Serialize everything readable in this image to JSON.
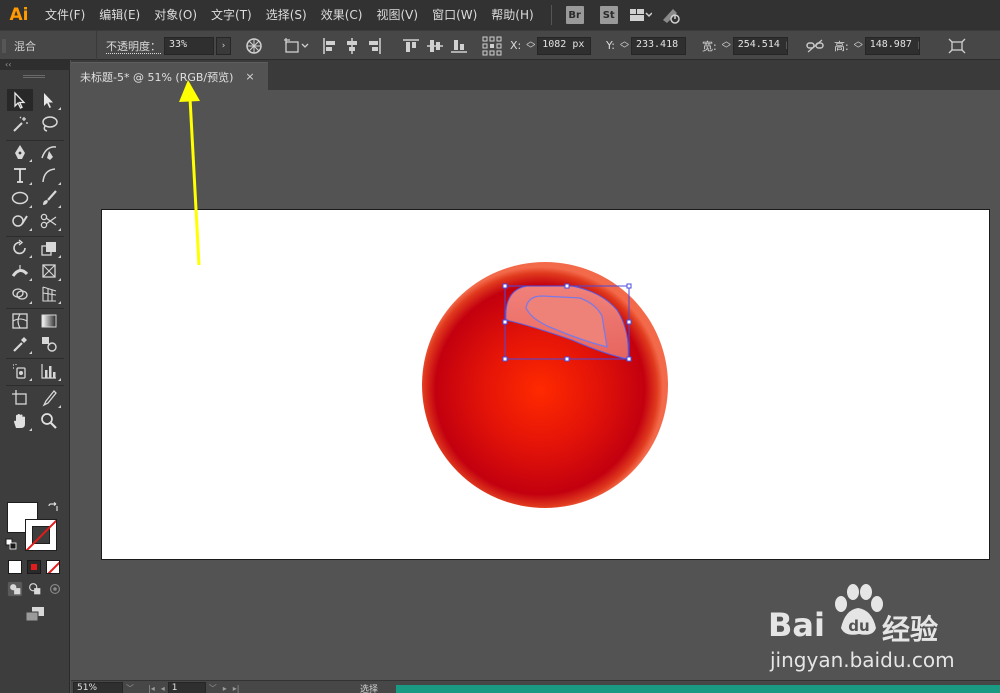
{
  "app": {
    "logo": "Ai",
    "brand_color": "#ff9a00"
  },
  "menu": {
    "items": [
      "文件(F)",
      "编辑(E)",
      "对象(O)",
      "文字(T)",
      "选择(S)",
      "效果(C)",
      "视图(V)",
      "窗口(W)",
      "帮助(H)"
    ],
    "bridge_label": "Br",
    "stock_label": "St"
  },
  "control_bar": {
    "mode_label": "混合",
    "opacity_label": "不透明度：",
    "opacity_value": "33%",
    "x_label": "X:",
    "x_value": "1082 px",
    "y_label": "Y:",
    "y_value": "233.418 p",
    "w_label": "宽:",
    "w_value": "254.514 p",
    "h_label": "高:",
    "h_value": "148.987 p"
  },
  "document": {
    "tab_title": "未标题-5* @ 51% (RGB/预览)",
    "tab_close": "×"
  },
  "artwork": {
    "sphere_colors": [
      "#ff2a00",
      "#e41408",
      "#c3000f",
      "#f36a4a"
    ],
    "highlight_color": "#f08a82",
    "selection_color": "#4a4adf"
  },
  "annotation": {
    "arrow_color": "#ffff00"
  },
  "status_bar": {
    "zoom": "51%",
    "artboard_number": "1",
    "mode_text": "选择",
    "progress_color": "#1a9a82"
  },
  "watermark": {
    "brand_left": "Bai",
    "brand_right": "经验",
    "url": "jingyan.baidu.com"
  }
}
